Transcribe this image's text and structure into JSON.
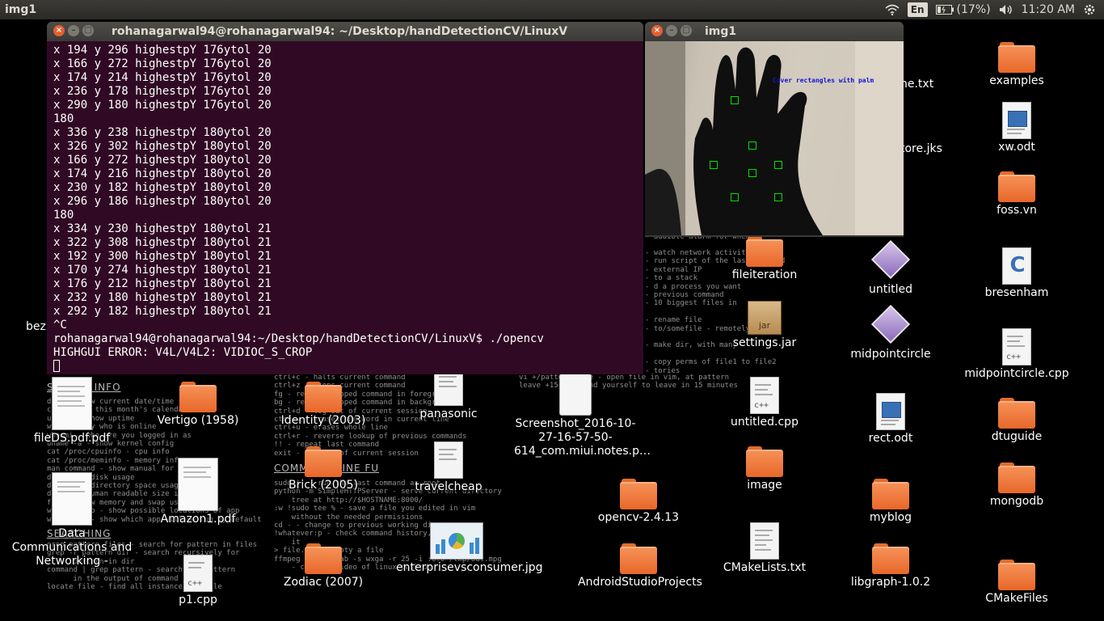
{
  "panel": {
    "app_title": "img1",
    "language": "En",
    "battery": "(17%)",
    "time": "11:20 AM"
  },
  "terminal": {
    "title": "rohanagarwal94@rohanagarwal94: ~/Desktop/handDetectionCV/LinuxV",
    "lines": [
      "x 194 y 296 highestpY 176ytol 20",
      "x 166 y 272 highestpY 176ytol 20",
      "x 174 y 214 highestpY 176ytol 20",
      "x 236 y 178 highestpY 176ytol 20",
      "x 290 y 180 highestpY 176ytol 20",
      "180",
      "x 336 y 238 highestpY 180ytol 20",
      "x 326 y 302 highestpY 180ytol 20",
      "x 166 y 272 highestpY 180ytol 20",
      "x 174 y 216 highestpY 180ytol 20",
      "x 230 y 182 highestpY 180ytol 20",
      "x 296 y 186 highestpY 180ytol 20",
      "180",
      "x 334 y 230 highestpY 180ytol 21",
      "x 322 y 308 highestpY 180ytol 21",
      "x 192 y 300 highestpY 180ytol 21",
      "x 170 y 274 highestpY 180ytol 21",
      "x 176 y 212 highestpY 180ytol 21",
      "x 232 y 180 highestpY 180ytol 21",
      "x 292 y 182 highestpY 180ytol 21",
      "^C",
      "rohanagarwal94@rohanagarwal94:~/Desktop/handDetectionCV/LinuxV$ ./opencv",
      "HIGHGUI ERROR: V4L/V4L2: VIDIOC_S_CROP"
    ]
  },
  "image_window": {
    "title": "img1",
    "overlay_text": "Cover rectangles with palm"
  },
  "cheatsheet": {
    "heading_sysinfo": "SYSTEM INFO",
    "heading_commands": "COMMAND LINE FU",
    "heading_searching": "SEARCHING",
    "block_left": "date - show current date/time\ncal - show this month's calendar\nuptime - show uptime\nw - display who is online\nwhoami - who are you logged in as\nuname -a - show kernel config\ncat /proc/cpuinfo - cpu info\ncat /proc/meminfo - memory info\nman command - show manual for command\ndf - show disk usage\ndu - show directory space usage\ndu -sh - human readable size in GB\nfree - show memory and swap usage\nwhereis app - show possible locations of app\nwhich app - show which app will be run by default",
    "block_search": "grep pattern files - search for pattern in files\ngrep -r pattern dir - search recursively for\n      pattern in dir\ncommand | grep pattern - search for pattern\n      in the output of command\nlocate file - find all instances of file",
    "block_mid_top": "ctrl+c - halts current command\nctrl+z - stops current command\nfg - resume stopped command in foreground\nbg - resume stopped command in background\nctrl+d - log out of current session\nctrl+w - erases one word in current line\nctrl+u - erases whole line\nctrl+r - reverse lookup of previous commands\n!! - repeat last command\nexit - log out of current session",
    "block_mid_bottom": "sudo !! - run the last command as root\npython -m SimpleHTTPServer - serve current directory\n    tree at http://$HOSTNAME:8000/\n:w !sudo tee % - save a file you edited in vim\n    without the needed permissions\ncd - - change to previous working directory\n!whatever:p - check command history, run it\n    it\n> file.txt - empty a file\nffmpeg -f x11grab -s wxga -r 25 -i :0.0 /tmp/out.mpg\n    - capture video of linux desktop",
    "block_right_top": "vi +/pattern file - open file in vim, at pattern\nleave +15 - remind yourself to leave in 15 minutes",
    "block_right_mid": "- watch network activity\n- run script of the last command\n- external IP\n- to a stack\n- d a process you want\n- previous command\n- 10 biggest files in\n\n- rename file\n- to/somefile - remotely edit\n\n- make dir, with many\n\n- copy perms of file1 to file2\n- tories",
    "fragment_right": "- audible alarm for when IP"
  },
  "desktop_icons": [
    {
      "label": "examples",
      "kind": "folder"
    },
    {
      "label": "he.txt",
      "kind": "partial"
    },
    {
      "label": "xw.odt",
      "kind": "odt"
    },
    {
      "label": "tore.jks",
      "kind": "partial"
    },
    {
      "label": "foss.vn",
      "kind": "folder"
    },
    {
      "label": "fileiteration",
      "kind": "folder"
    },
    {
      "label": "untitled",
      "kind": "diamond"
    },
    {
      "label": "bresenham",
      "kind": "cfile"
    },
    {
      "label": "settings.jar",
      "kind": "jar"
    },
    {
      "label": "midpointcircle",
      "kind": "diamond"
    },
    {
      "label": "midpointcircle.cpp",
      "kind": "cpp"
    },
    {
      "label": "untitled.cpp",
      "kind": "cpp"
    },
    {
      "label": "rect.odt",
      "kind": "odt"
    },
    {
      "label": "dtuguide",
      "kind": "folder"
    },
    {
      "label": "image",
      "kind": "folder"
    },
    {
      "label": "mongodb",
      "kind": "folder"
    },
    {
      "label": "opencv-2.4.13",
      "kind": "folder"
    },
    {
      "label": "myblog",
      "kind": "folder"
    },
    {
      "label": "CMakeLists.txt",
      "kind": "doc"
    },
    {
      "label": "AndroidStudioProjects",
      "kind": "folder"
    },
    {
      "label": "libgraph-1.0.2",
      "kind": "folder"
    },
    {
      "label": "CMakeFiles",
      "kind": "folder"
    },
    {
      "label": "Vertigo (1958)",
      "kind": "folder"
    },
    {
      "label": "Identity (2003)",
      "kind": "folder"
    },
    {
      "label": "panasonic",
      "kind": "doc"
    },
    {
      "label": "Screenshot_2016-10-27-16-57-50-614_com.miui.notes.p…",
      "kind": "screenshot"
    },
    {
      "label": "fileDS.pdf.pdf",
      "kind": "pdf"
    },
    {
      "label": "Brick (2005)",
      "kind": "folder"
    },
    {
      "label": "travelcheap",
      "kind": "doc"
    },
    {
      "label": "Amazon1.pdf",
      "kind": "pdf"
    },
    {
      "label": "Data Communications and Networking -",
      "kind": "pdf"
    },
    {
      "label": "enterprisevsconsumer.jpg",
      "kind": "image"
    },
    {
      "label": "Zodiac (2007)",
      "kind": "folder"
    },
    {
      "label": "p1.cpp",
      "kind": "cpp"
    },
    {
      "label": "bezi",
      "kind": "partial"
    }
  ]
}
